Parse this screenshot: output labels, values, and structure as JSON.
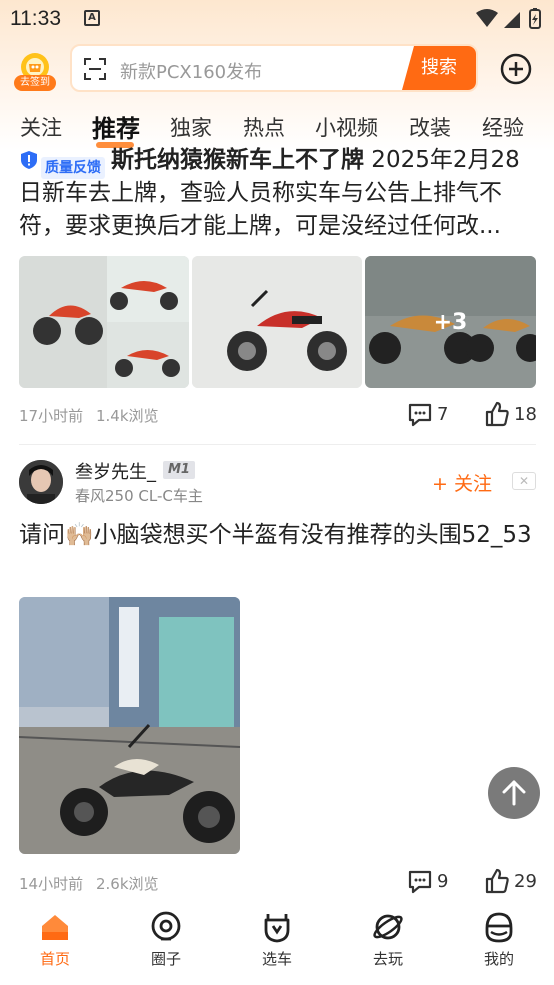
{
  "status_bar": {
    "time": "11:33",
    "notification_icon": "A"
  },
  "header": {
    "checkin_label": "去签到",
    "search_placeholder": "新款PCX160发布",
    "search_button": "搜索"
  },
  "tabs": [
    {
      "label": "关注",
      "active": false
    },
    {
      "label": "推荐",
      "active": true
    },
    {
      "label": "独家",
      "active": false
    },
    {
      "label": "热点",
      "active": false
    },
    {
      "label": "小视频",
      "active": false
    },
    {
      "label": "改装",
      "active": false
    },
    {
      "label": "经验",
      "active": false
    }
  ],
  "post1": {
    "badge": "质量反馈",
    "title": "斯托纳猿猴新车上不了牌",
    "body": " 2025年2月28日新车去上牌，查验人员称实车与公告上排气不符，要求更换后才能上牌，可是没经过任何改...",
    "more_images": "+3",
    "time": "17小时前",
    "views": "1.4k浏览",
    "comments": "7",
    "likes": "18"
  },
  "post2": {
    "username": "叁岁先生_",
    "level": "M1",
    "user_sub": "春风250 CL-C车主",
    "follow_label": "+ 关注",
    "close_label": "✕",
    "text": "请问🙌🏼小脑袋想买个半盔有没有推荐的头围52_53",
    "time": "14小时前",
    "views": "2.6k浏览",
    "comments": "9",
    "likes": "29"
  },
  "bottom_nav": [
    {
      "label": "首页",
      "icon": "home-icon",
      "active": true
    },
    {
      "label": "圈子",
      "icon": "circle-icon",
      "active": false
    },
    {
      "label": "选车",
      "icon": "car-select-icon",
      "active": false
    },
    {
      "label": "去玩",
      "icon": "planet-icon",
      "active": false
    },
    {
      "label": "我的",
      "icon": "profile-icon",
      "active": false
    }
  ],
  "colors": {
    "accent": "#ff6a13",
    "badge_blue": "#2d6df6"
  }
}
